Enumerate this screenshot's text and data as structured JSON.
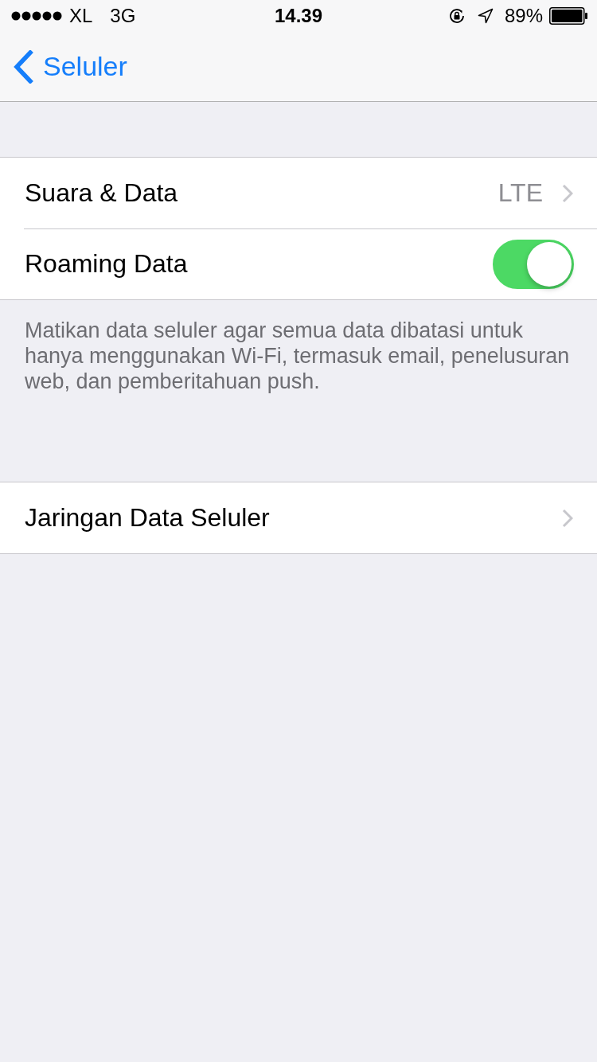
{
  "status_bar": {
    "carrier": "XL",
    "network": "3G",
    "time": "14.39",
    "battery": "89%"
  },
  "nav_bar": {
    "back_label": "Seluler"
  },
  "groups": [
    {
      "rows": [
        {
          "kind": "link",
          "label": "Suara & Data",
          "value": "LTE"
        },
        {
          "kind": "toggle",
          "label": "Roaming Data",
          "on": true
        }
      ],
      "footer": "Matikan data seluler agar semua data dibatasi untuk hanya menggunakan Wi-Fi, termasuk email, penelusuran web, dan pemberitahuan push."
    },
    {
      "rows": [
        {
          "kind": "link",
          "label": "Jaringan Data Seluler"
        }
      ]
    }
  ]
}
